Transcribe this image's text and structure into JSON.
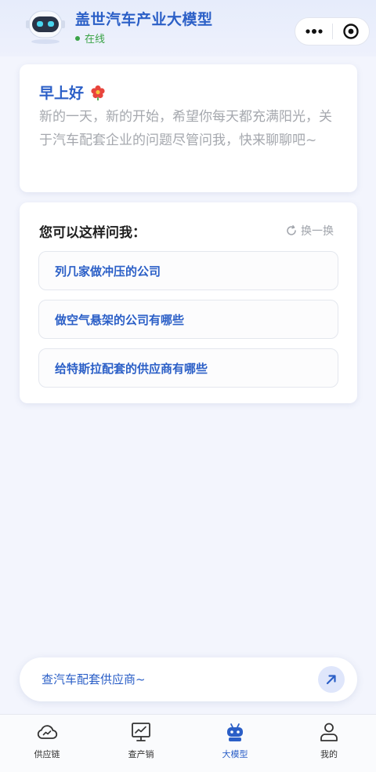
{
  "header": {
    "title": "盖世汽车产业大模型",
    "status": "在线",
    "avatar_icon": "robot-avatar-icon",
    "capsule": {
      "more_icon": "more-dots-icon",
      "target_icon": "target-icon"
    }
  },
  "greeting": {
    "title": "早上好",
    "emoji_icon": "red-flower-icon",
    "body": "新的一天，新的开始，希望你每天都充满阳光，关于汽车配套企业的问题尽管问我，快来聊聊吧~"
  },
  "suggestions": {
    "title": "您可以这样问我：",
    "refresh_label": "换一换",
    "items": [
      "列几家做冲压的公司",
      "做空气悬架的公司有哪些",
      "给特斯拉配套的供应商有哪些"
    ]
  },
  "input": {
    "placeholder": "查汽车配套供应商~",
    "send_icon": "arrow-up-right-icon"
  },
  "tabbar": {
    "items": [
      {
        "label": "供应链",
        "icon": "cloud-chart-icon",
        "active": false
      },
      {
        "label": "查产销",
        "icon": "monitor-chart-icon",
        "active": false
      },
      {
        "label": "大模型",
        "icon": "robot-icon",
        "active": true
      },
      {
        "label": "我的",
        "icon": "user-icon",
        "active": false
      }
    ]
  },
  "colors": {
    "brand_blue": "#2b5fc7",
    "online_green": "#3aa347",
    "background": "#f3f5fd"
  }
}
